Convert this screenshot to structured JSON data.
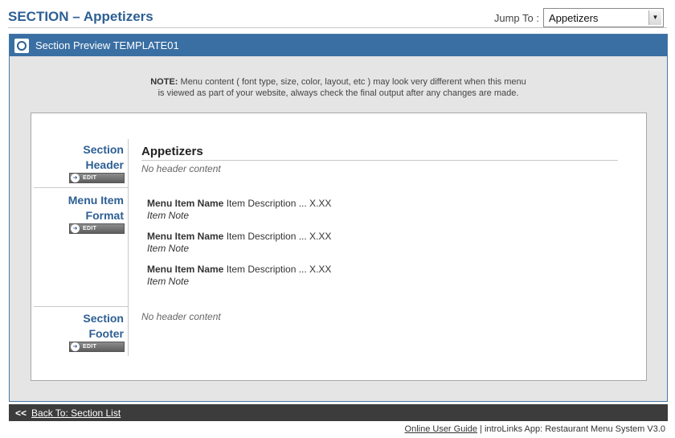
{
  "page": {
    "title": "SECTION – Appetizers",
    "jump_label": "Jump To :",
    "jump_value": "Appetizers"
  },
  "panel": {
    "title": "Section Preview TEMPLATE01"
  },
  "note": {
    "bold": "NOTE:",
    "line1": " Menu content ( font type, size, color, layout, etc ) may look very different when this menu",
    "line2": "is viewed as part of your website, always check the final output after any changes are made."
  },
  "sidebar": {
    "section_header": [
      "Section",
      "Header"
    ],
    "menu_item_format": [
      "Menu Item",
      "Format"
    ],
    "section_footer": [
      "Section",
      "Footer"
    ],
    "edit_label": "EDIT"
  },
  "preview": {
    "section_name": "Appetizers",
    "header_content": "No header content",
    "footer_content": "No header content",
    "items": [
      {
        "name": "Menu Item Name",
        "desc": " Item Description ... X.XX",
        "note": "Item Note"
      },
      {
        "name": "Menu Item Name",
        "desc": " Item Description ... X.XX",
        "note": "Item Note"
      },
      {
        "name": "Menu Item Name",
        "desc": " Item Description ... X.XX",
        "note": "Item Note"
      }
    ]
  },
  "bottom": {
    "prefix": "<<",
    "back_link": "Back To: Section List"
  },
  "footer": {
    "guide_link": "Online User Guide",
    "app_text": " | introLinks App: Restaurant Menu System V3.0"
  },
  "colors": {
    "title_blue": "#2d5f94",
    "header_blue": "#3a6fa3",
    "bottom_bar": "#3c3c3c"
  }
}
